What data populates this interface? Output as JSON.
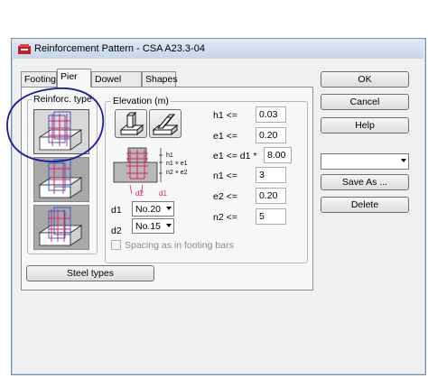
{
  "window": {
    "title": "Reinforcement Pattern - CSA A23.3-04"
  },
  "tabs": [
    {
      "label": "Footing",
      "active": false
    },
    {
      "label": "Pier",
      "active": true
    },
    {
      "label": "Dowel Bars",
      "active": false
    },
    {
      "label": "Shapes",
      "active": false
    }
  ],
  "reinforc_type": {
    "label": "Reinforc. type"
  },
  "elevation": {
    "label": "Elevation (m)"
  },
  "params": [
    {
      "label": "h1 <=",
      "value": "0.03"
    },
    {
      "label": "e1 <=",
      "value": "0.20"
    },
    {
      "label": "e1 <= d1 *",
      "value": "8.00"
    },
    {
      "label": "n1 <=",
      "value": "3"
    },
    {
      "label": "e2 <=",
      "value": "0.20"
    },
    {
      "label": "n2 <=",
      "value": "5"
    }
  ],
  "bars": {
    "d1_label": "d1",
    "d1_value": "No.20",
    "d2_label": "d2",
    "d2_value": "No.15"
  },
  "spacing_checkbox": {
    "label": "Spacing as in footing bars",
    "checked": false,
    "enabled": false
  },
  "diagram": {
    "h1": "h1",
    "n1e1": "n1 × e1",
    "n2e2": "n2 × e2",
    "d1": "d1",
    "d2": "d2"
  },
  "buttons": {
    "steel_types": "Steel types",
    "ok": "OK",
    "cancel": "Cancel",
    "help": "Help",
    "save_as": "Save As ...",
    "delete": "Delete"
  },
  "pattern_combo": {
    "value": ""
  },
  "colors": {
    "annotation_circle": "#1a1aa8",
    "rebar": "#e0206a",
    "accent": "#2255cc"
  }
}
